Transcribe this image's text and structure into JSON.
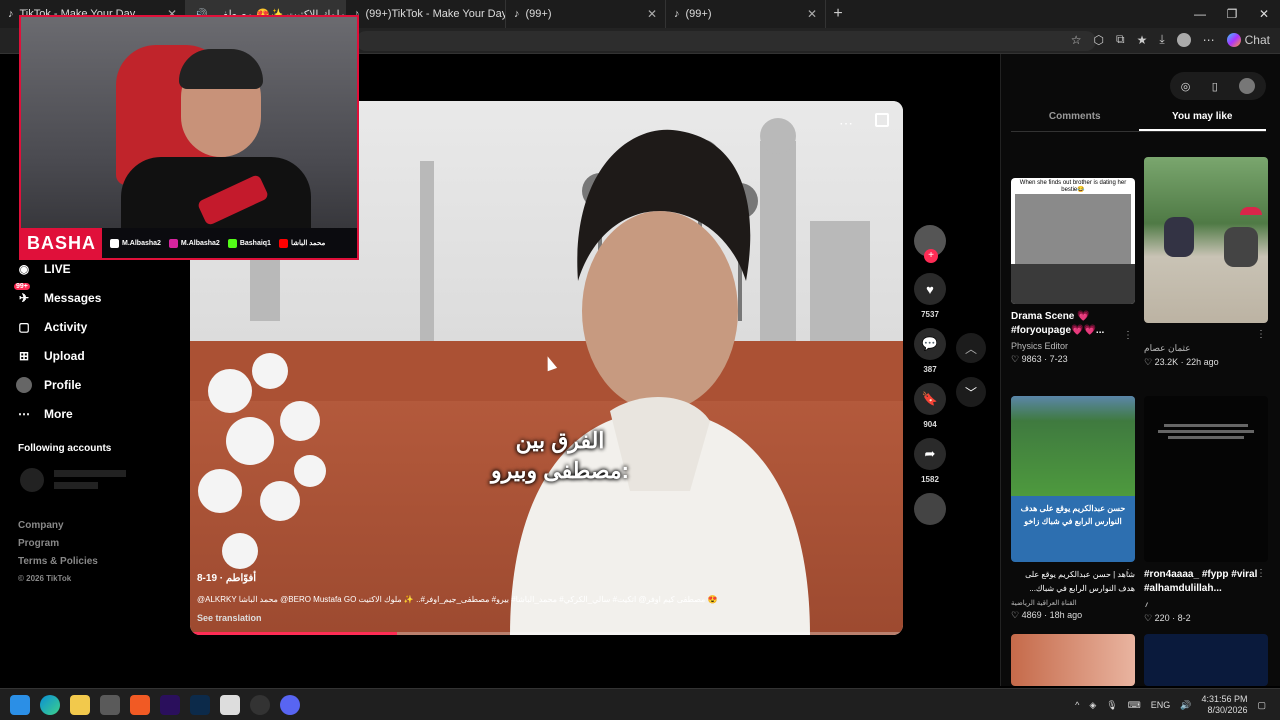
{
  "browser": {
    "tabs": [
      {
        "title": "TikTok - Make Your Day"
      },
      {
        "title": "ملوك الاكتيت ✨😍 مصطفى"
      },
      {
        "title": "(99+)TikTok - Make Your Day"
      },
      {
        "title": "(99+)"
      },
      {
        "title": "(99+)"
      }
    ],
    "new_tab": "+",
    "chat_label": "Chat"
  },
  "stream_overlay": {
    "brand": "BASHA",
    "socials": [
      {
        "handle": "M.Albasha2",
        "icon": "tiktok-icon",
        "color": "#ffffff"
      },
      {
        "handle": "M.Albasha2",
        "icon": "instagram-icon",
        "color": "#d6249f"
      },
      {
        "handle": "Bashaiq1",
        "icon": "kick-icon",
        "color": "#53fc18"
      },
      {
        "handle": "محمد الباشا",
        "icon": "youtube-icon",
        "color": "#ff0000"
      }
    ]
  },
  "sidebar": {
    "items": [
      {
        "label": "LIVE",
        "icon": "live-icon"
      },
      {
        "label": "Messages",
        "icon": "messages-icon",
        "badge": "99+"
      },
      {
        "label": "Activity",
        "icon": "activity-icon"
      },
      {
        "label": "Upload",
        "icon": "upload-icon"
      },
      {
        "label": "Profile",
        "icon": "profile-icon"
      },
      {
        "label": "More",
        "icon": "more-icon"
      }
    ],
    "following_title": "Following accounts",
    "footer": [
      "Company",
      "Program",
      "Terms & Policies"
    ],
    "copyright": "© 2026 TikTok"
  },
  "video": {
    "caption_line1": "الفرق بين",
    "caption_line2": "مصطفى وبيرو:",
    "author_date": "أفوّاطم‏ · 8-19",
    "description": "@ALKRKY محمد الباشا @BERO Mustafa GO مصطفى كيم اوفر@ اتكيت# سالي_الكركي# محمد_الباشا# بيرو# مصطفى_جيم_اوفر#.. ✨ ملوك الاكتيت 😍",
    "see_translation": "See translation",
    "progress": 0.29,
    "likes": "7537",
    "comments": "387",
    "saves": "904",
    "shares": "1582"
  },
  "right_panel": {
    "tabs": [
      "Comments",
      "You may like"
    ],
    "active_tab": 1,
    "cards": [
      {
        "thumb_text": "When she finds out brother is dating her bestie😂",
        "title": "Drama Scene 💗 #foryoupage💗💗...",
        "author": "Physics Editor",
        "likes": "9863",
        "date": "7-23"
      },
      {
        "thumb_text": "",
        "title": "",
        "author": "عثمان عصام",
        "likes": "23.2K",
        "date": "22h ago"
      },
      {
        "thumb_text": "حسن عبدالكريم يوقع على هدف النوارس الرابع في شباك زاخو",
        "title": "شاهد | حسن عبدالكريم يوقع على هدف النوارس الرابع في شباك...",
        "author": "القناة العراقية الرياضية",
        "likes": "4869",
        "date": "18h ago"
      },
      {
        "thumb_text": "",
        "title": "#ron4aaaa_ #fypp #viral #alhamdulillah...",
        "author": "؍",
        "likes": "220",
        "date": "8-2"
      }
    ]
  },
  "taskbar": {
    "lang": "ENG",
    "time": "4:31:56 PM",
    "date": "8/30/2026"
  },
  "colors": {
    "accent": "#fe2c55",
    "overlay_red": "#e0103a"
  }
}
